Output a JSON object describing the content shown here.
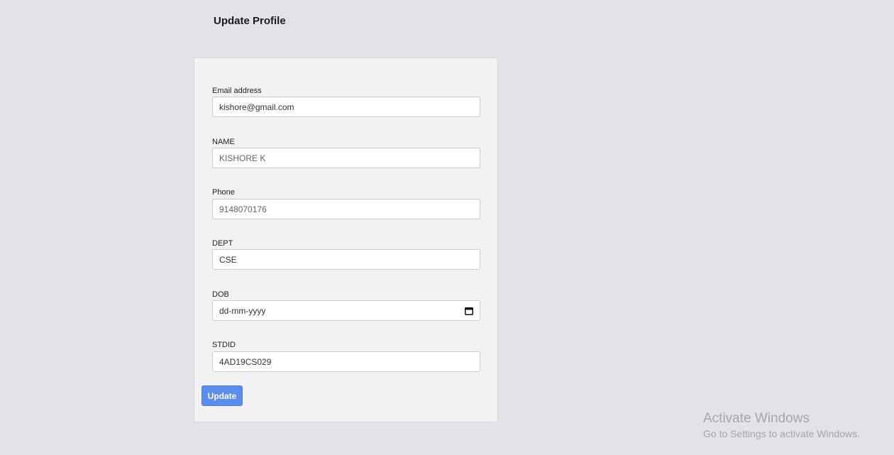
{
  "page": {
    "title": "Update Profile"
  },
  "form": {
    "email": {
      "label": "Email address",
      "value": "kishore@gmail.com"
    },
    "name": {
      "label": "NAME",
      "value": "KISHORE K"
    },
    "phone": {
      "label": "Phone",
      "value": "9148070176"
    },
    "dept": {
      "label": "DEPT",
      "value": "CSE"
    },
    "dob": {
      "label": "DOB",
      "placeholder": "dd-mm-yyyy",
      "icon": "calendar-icon"
    },
    "stdid": {
      "label": "STDID",
      "value": "4AD19CS029"
    },
    "submit_label": "Update"
  },
  "watermark": {
    "title": "Activate Windows",
    "subtitle": "Go to Settings to activate Windows."
  },
  "colors": {
    "background": "#e1e3e8",
    "card": "#f2f2f2",
    "button": "#5b8dee"
  }
}
